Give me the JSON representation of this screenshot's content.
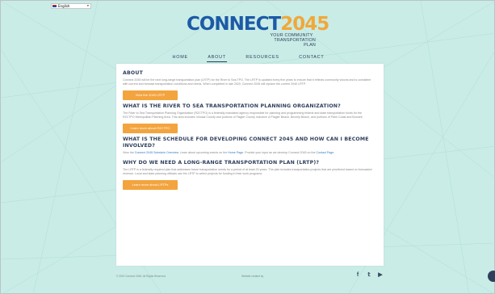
{
  "language": {
    "selected": "English"
  },
  "logo": {
    "word_main": "CONNECT",
    "word_year": "2045",
    "tag_line1": "Your Community",
    "tag_line2": "Transportation Plan"
  },
  "nav": {
    "items": [
      "Home",
      "About",
      "Resources",
      "Contact"
    ],
    "active": "About"
  },
  "about": {
    "title": "About",
    "body": "Connect 2045 will be the next long-range transportation plan (LRTP) for the River to Sea TPO. The LRTP is updated every five years to ensure that it reflects community visions and is consistent with current and forecast transportation conditions and needs. When completed in late 2020, Connect 2045 will replace the current 2040 LRTP.",
    "button": "View the 2040 LRTP"
  },
  "tpo": {
    "title": "What is the River to Sea Transportation Planning Organization?",
    "body": "The River to Sea Transportation Planning Organization (R2CTPO) is a federally mandated agency responsible for planning and programming federal and state transportation funds for the R2CTPO Metropolitan Planning Area. This area includes Volusia County and portions of Flagler County inclusive of Flagler Beach, Beverly Beach, and portions of Palm Coast and Bunnell.",
    "button": "Learn more about R2CTPO"
  },
  "schedule": {
    "title": "What is the schedule for developing Connect 2045 and how can I become involved?",
    "body_prefix": "View the ",
    "link1": "Connect 2045 Schedule Overview",
    "body_mid": ". Learn about upcoming events on the ",
    "link2": "Home Page",
    "body_mid2": ". Provide your input as we develop Connect 2045 on the ",
    "link3": "Contact Page",
    "body_suffix": "."
  },
  "why": {
    "title": "Why do we need a long-range transportation plan (LRTP)?",
    "body": "The LRTP is a federally required plan that addresses future transportation needs for a period of at least 20 years. The plan includes transportation projects that are prioritized based on forecasted revenue. Local and state planning officials use the LRTP to select projects for funding in their work programs.",
    "button": "Learn more about LRTPs"
  },
  "footer": {
    "copyright": "© 2019 Connect 2045. All Rights Reserved.",
    "credit": "Website created by",
    "social": [
      "facebook-icon",
      "twitter-icon",
      "youtube-icon"
    ],
    "social_glyphs": [
      "f",
      "𝕥",
      "▶"
    ]
  },
  "colors": {
    "background": "#c9ece7",
    "accent": "#f3a43e",
    "heading": "#2e3f5c",
    "logo_blue": "#1d5aa6",
    "logo_orange": "#f0a83a"
  }
}
